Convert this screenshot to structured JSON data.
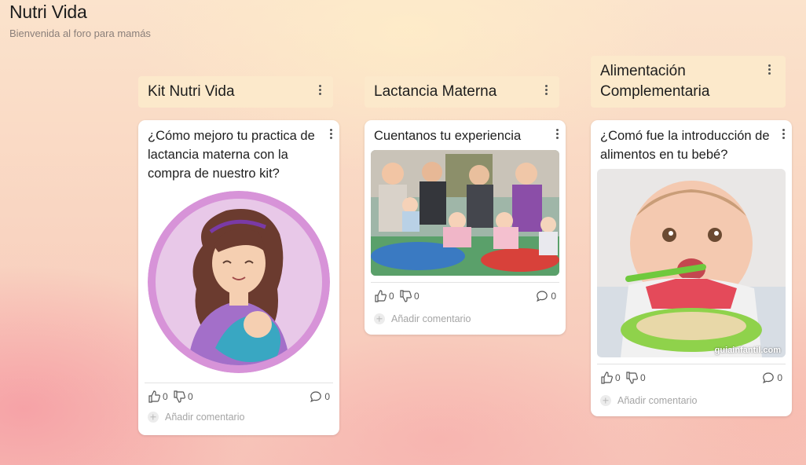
{
  "board": {
    "title": "Nutri Vida",
    "subtitle": "Bienvenida al foro para mamás"
  },
  "columns": [
    {
      "title": "Kit Nutri Vida",
      "card": {
        "title": "¿Cómo mejoro tu practica de lactancia materna con la compra de nuestro kit?",
        "image": "breastfeeding-mother-illustration",
        "likes": "0",
        "dislikes": "0",
        "comments": "0",
        "comment_placeholder": "Añadir comentario"
      }
    },
    {
      "title": "Lactancia Materna",
      "card": {
        "title": "Cuentanos tu experiencia",
        "image": "mothers-and-babies-group-photo",
        "likes": "0",
        "dislikes": "0",
        "comments": "0",
        "comment_placeholder": "Añadir comentario"
      }
    },
    {
      "title": "Alimentación Complementaria",
      "card": {
        "title": "¿Comó fue la introducción de alimentos en tu bebé?",
        "image": "baby-eating-photo",
        "watermark": "guiainfantil.com",
        "likes": "0",
        "dislikes": "0",
        "comments": "0",
        "comment_placeholder": "Añadir comentario"
      }
    }
  ],
  "colors": {
    "column_header_bg": "#fce9cb",
    "card_bg": "#ffffff",
    "accent_purple": "#d88fd8"
  },
  "icons": [
    "more-options-icon",
    "thumbs-up-icon",
    "thumbs-down-icon",
    "comment-icon",
    "plus-icon"
  ]
}
